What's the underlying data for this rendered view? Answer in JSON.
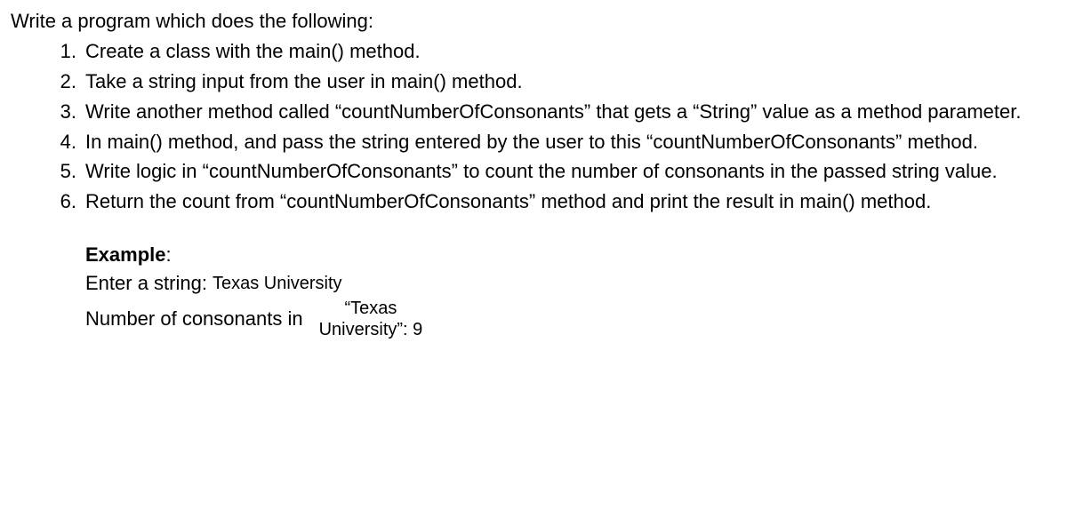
{
  "intro": "Write a program which does the following:",
  "items": [
    {
      "num": "1.",
      "text": "Create a class with the main() method."
    },
    {
      "num": "2.",
      "text": "Take a string input from the user in main() method."
    },
    {
      "num": "3.",
      "text": "Write another method called “countNumberOfConsonants” that gets a “String” value as a method parameter."
    },
    {
      "num": "4.",
      "text": "In main() method, and pass the string entered by the user to this “countNumberOfConsonants” method."
    },
    {
      "num": "5.",
      "text": "Write logic in “countNumberOfConsonants” to count the number of consonants in the passed string value."
    },
    {
      "num": "6.",
      "text": "Return the count from “countNumberOfConsonants” method and print the result in main() method."
    }
  ],
  "example": {
    "label": "Example",
    "colon": ":",
    "line1_prefix": "Enter a string:",
    "line1_value": "Texas University",
    "line2_prefix": "Number of consonants in",
    "stacked_top": "“Texas",
    "stacked_bottom": "University”: 9"
  }
}
